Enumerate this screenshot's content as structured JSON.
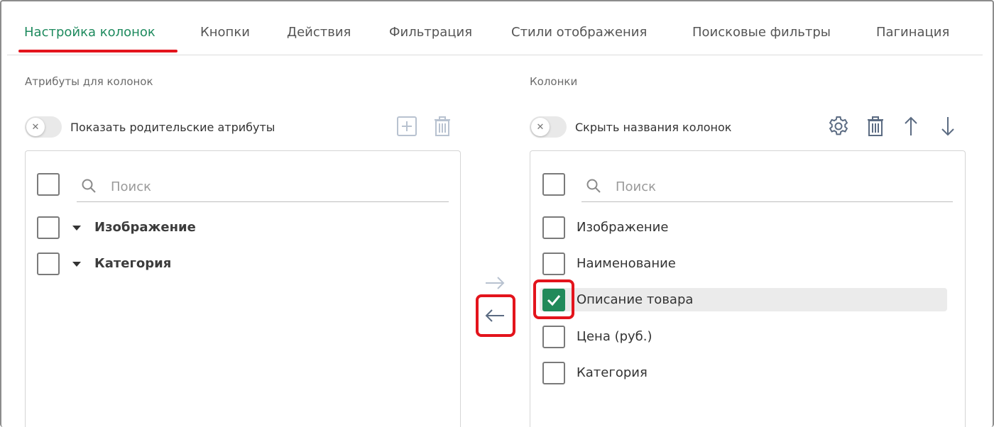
{
  "tabs": [
    {
      "label": "Настройка колонок",
      "active": true
    },
    {
      "label": "Кнопки"
    },
    {
      "label": "Действия"
    },
    {
      "label": "Фильтрация"
    },
    {
      "label": "Стили отображения"
    },
    {
      "label": "Поисковые фильтры"
    },
    {
      "label": "Пагинация"
    }
  ],
  "left": {
    "title": "Атрибуты для колонок",
    "toggle_label": "Показать родительские атрибуты",
    "toggle_on": false,
    "toolbar_icons": [
      "add-icon",
      "trash-icon"
    ],
    "search_placeholder": "Поиск",
    "items": [
      {
        "label": "Изображение",
        "expandable": true,
        "checked": false
      },
      {
        "label": "Категория",
        "expandable": true,
        "checked": false
      }
    ]
  },
  "right": {
    "title": "Колонки",
    "toggle_label": "Скрыть названия колонок",
    "toggle_on": false,
    "toolbar_icons": [
      "gear-icon",
      "trash-icon",
      "arrow-up-icon",
      "arrow-down-icon"
    ],
    "search_placeholder": "Поиск",
    "items": [
      {
        "label": "Изображение",
        "checked": false
      },
      {
        "label": "Наименование",
        "checked": false
      },
      {
        "label": "Описание товара",
        "checked": true,
        "selected": true
      },
      {
        "label": "Цена (руб.)",
        "checked": false
      },
      {
        "label": "Категория",
        "checked": false
      }
    ]
  },
  "transfer": {
    "move_right_icon": "arrow-right-icon",
    "move_left_icon": "arrow-left-icon"
  },
  "colors": {
    "accent": "#1e8a5e",
    "checkbox_checked": "#218a5a",
    "highlight_annotation": "#e3141c",
    "icon": "#5b6b82",
    "icon_disabled": "#b8c2d0"
  }
}
